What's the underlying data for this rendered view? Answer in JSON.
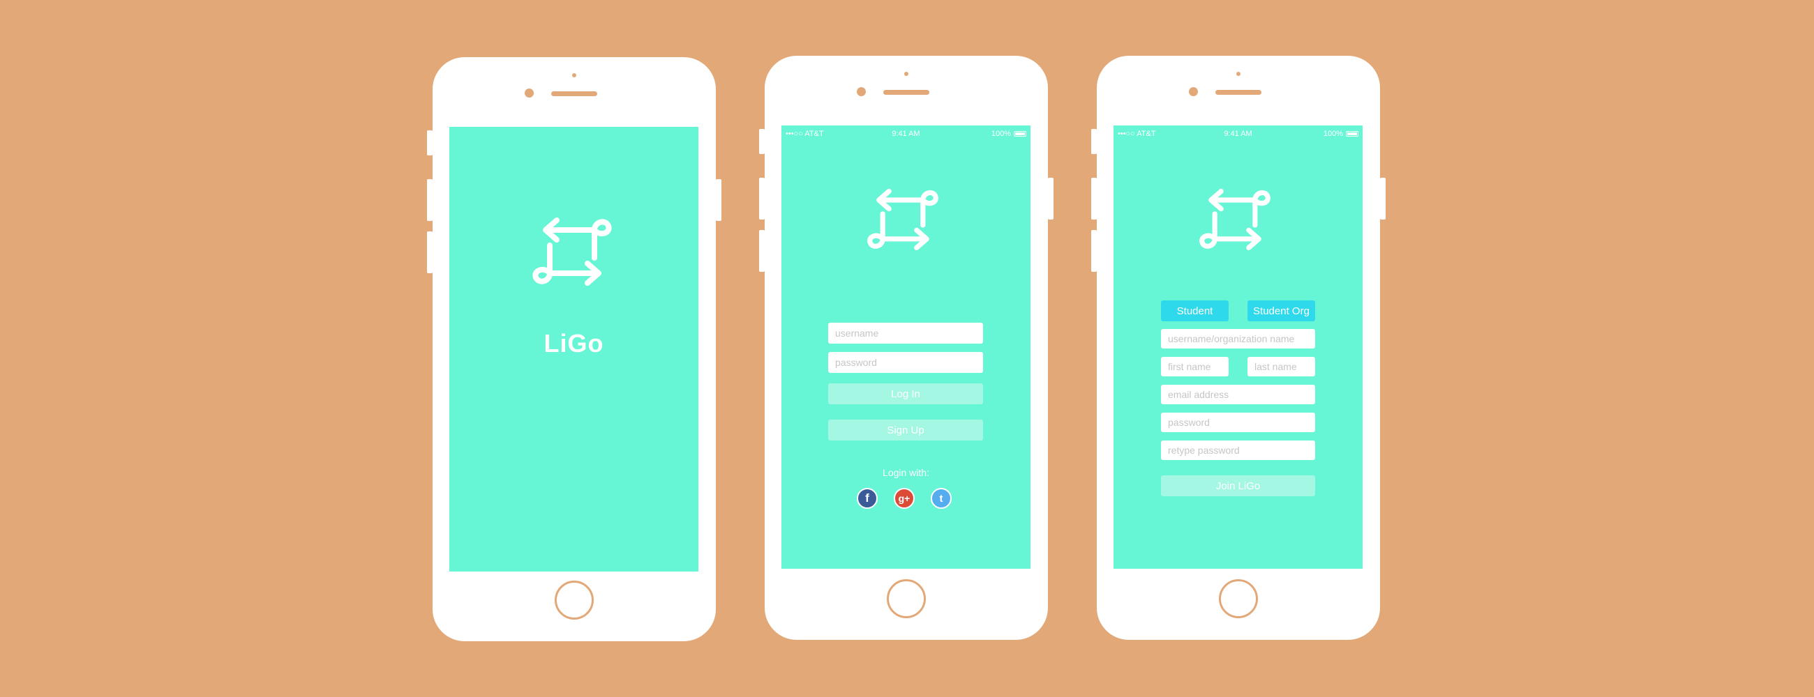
{
  "colors": {
    "background": "#e2a878",
    "screen": "#67f6d5",
    "button_light": "#a3f7e3",
    "toggle": "#2fd9ec",
    "facebook": "#3b5a98",
    "google_plus": "#dc4a38",
    "twitter": "#55acee"
  },
  "splash": {
    "brand": "LiGo"
  },
  "status_bar": {
    "carrier": "•••○○ AT&T",
    "time": "9:41 AM",
    "battery": "100%"
  },
  "login": {
    "username_placeholder": "username",
    "password_placeholder": "password",
    "login_label": "Log In",
    "signup_label": "Sign Up",
    "login_with": "Login with:",
    "social": [
      {
        "icon": "facebook-icon",
        "glyph": "f"
      },
      {
        "icon": "google-plus-icon",
        "glyph": "g+"
      },
      {
        "icon": "twitter-icon",
        "glyph": "t"
      }
    ]
  },
  "signup": {
    "toggle_student": "Student",
    "toggle_org": "Student Org",
    "username_placeholder": "username/organization name",
    "first_name_placeholder": "first name",
    "last_name_placeholder": "last name",
    "email_placeholder": "email address",
    "password_placeholder": "password",
    "retype_placeholder": "retype password",
    "join_label": "Join LiGo"
  }
}
